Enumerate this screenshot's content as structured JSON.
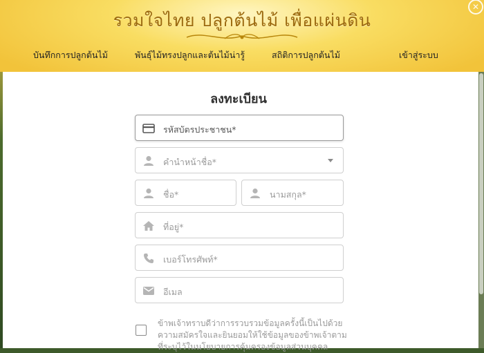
{
  "header": {
    "title": "รวมใจไทย ปลูกต้นไม้ เพื่อแผ่นดิน",
    "nav": [
      "บันทึกการปลูกต้นไม้",
      "พันธุ์ไม้ทรงปลูกและต้นไม้น่ารู้",
      "สถิติการปลูกต้นไม้",
      "เข้าสู่ระบบ"
    ]
  },
  "form": {
    "title": "ลงทะเบียน",
    "fields": {
      "id_card": "รหัสบัตรประชาชน*",
      "prefix": "คำนำหน้าชื่อ*",
      "first_name": "ชื่อ*",
      "last_name": "นามสกุล*",
      "address": "ที่อยู่*",
      "phone": "เบอร์โทรศัพท์*",
      "email": "อีเมล"
    },
    "consent_text": "ข้าพเจ้าทราบดีว่าการรวบรวมข้อมูลครั้งนี้เป็นไปด้วยความสมัครใจและยินยอมให้ใช้ข้อมูลของข้าพเจ้าตามที่ระบุไว้ในนโยบายการคุ้มครองข้อมูลส่วนบุคคล"
  },
  "icons": [
    "close-icon",
    "id-card-icon",
    "person-icon",
    "home-icon",
    "phone-icon",
    "mail-icon",
    "chevron-down-icon"
  ],
  "colors": {
    "header_gold": "#f2c33a",
    "title_brown": "#9c6a10",
    "icon_gray": "#8f8f8f"
  }
}
